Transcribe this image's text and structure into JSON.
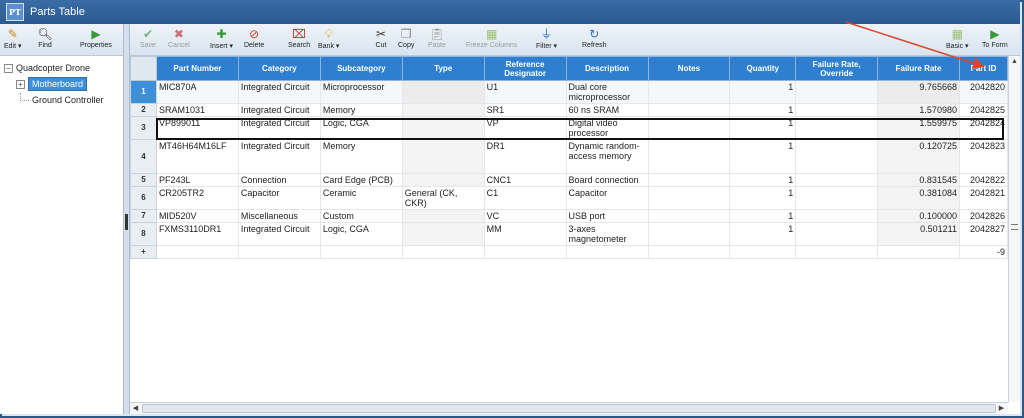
{
  "window": {
    "logo_text": "PT",
    "title": "Parts Table"
  },
  "left_toolbar": [
    {
      "label": "Edit ▾",
      "icon": "pencil-icon",
      "glyph": "✎",
      "color": "#d08a10"
    },
    {
      "label": "Find",
      "icon": "magnifier-icon",
      "glyph": "🔍︎",
      "color": "#333333"
    },
    {
      "label": "Properties",
      "icon": "play-icon",
      "glyph": "▶",
      "color": "#3a9a3a"
    }
  ],
  "tree": {
    "root": "Quadcopter Drone",
    "root_toggle": "−",
    "child_toggle": "+",
    "children": [
      "Motherboard",
      "Ground Controller"
    ]
  },
  "toolbar": [
    {
      "label": "Save",
      "icon": "check-icon",
      "glyph": "✔",
      "color": "#7ab07a",
      "disabled": true
    },
    {
      "label": "Cancel",
      "icon": "cancel-icon",
      "glyph": "✖",
      "color": "#d07070",
      "disabled": true
    },
    {
      "label": "Insert ▾",
      "icon": "add-icon",
      "glyph": "✚",
      "color": "#2e9a2e",
      "disabled": false
    },
    {
      "label": "Delete",
      "icon": "delete-icon",
      "glyph": "⊘",
      "color": "#d04020",
      "disabled": false
    },
    {
      "label": "Search",
      "icon": "search-icon",
      "glyph": "⌧",
      "color": "#c03030",
      "disabled": false
    },
    {
      "label": "Bank ▾",
      "icon": "lightbulb-icon",
      "glyph": "💡︎",
      "color": "#e0b020",
      "disabled": false
    },
    {
      "label": "Cut",
      "icon": "scissors-icon",
      "glyph": "✂",
      "color": "#333333",
      "disabled": false
    },
    {
      "label": "Copy",
      "icon": "copy-icon",
      "glyph": "❐",
      "color": "#888888",
      "disabled": false
    },
    {
      "label": "Paste",
      "icon": "paste-icon",
      "glyph": "📋︎",
      "color": "#999999",
      "disabled": true
    },
    {
      "label": "Freeze Columns",
      "icon": "freeze-columns-icon",
      "glyph": "▦",
      "color": "#9fbf70",
      "disabled": true
    },
    {
      "label": "Filter ▾",
      "icon": "filter-icon",
      "glyph": "⏚",
      "color": "#3070c0",
      "disabled": false
    },
    {
      "label": "Refresh",
      "icon": "refresh-icon",
      "glyph": "↻",
      "color": "#3070c0",
      "disabled": false
    },
    {
      "label": "Basic ▾",
      "icon": "basic-view-icon",
      "glyph": "▦",
      "color": "#9fbf70",
      "disabled": false
    },
    {
      "label": "To Form",
      "icon": "to-form-icon",
      "glyph": "▶",
      "color": "#3a9a3a",
      "disabled": false
    }
  ],
  "columns": [
    "Part Number",
    "Category",
    "Subcategory",
    "Type",
    "Reference Designator",
    "Description",
    "Notes",
    "Quantity",
    "Failure Rate, Override",
    "Failure Rate",
    "Part ID"
  ],
  "rows": [
    {
      "n": "1",
      "part": "MIC870A",
      "cat": "Integrated Circuit",
      "sub": "Microprocessor",
      "type": "",
      "ref": "U1",
      "desc": "Dual core microprocessor",
      "notes": "",
      "qty": "1",
      "fro": "",
      "fr": "9.765668",
      "id": "2042820"
    },
    {
      "n": "2",
      "part": "SRAM1031",
      "cat": "Integrated Circuit",
      "sub": "Memory",
      "type": "",
      "ref": "SR1",
      "desc": "60 ns SRAM",
      "notes": "",
      "qty": "1",
      "fro": "",
      "fr": "1.570980",
      "id": "2042825"
    },
    {
      "n": "3",
      "part": "VP899011",
      "cat": "Integrated Circuit",
      "sub": "Logic, CGA",
      "type": "",
      "ref": "VP",
      "desc": "Digital video processor",
      "notes": "",
      "qty": "1",
      "fro": "",
      "fr": "1.559975",
      "id": "2042824"
    },
    {
      "n": "4",
      "part": "MT46H64M16LF",
      "cat": "Integrated Circuit",
      "sub": "Memory",
      "type": "",
      "ref": "DR1",
      "desc": "Dynamic random-access memory",
      "notes": "",
      "qty": "1",
      "fro": "",
      "fr": "0.120725",
      "id": "2042823"
    },
    {
      "n": "5",
      "part": "PF243L",
      "cat": "Connection",
      "sub": "Card Edge (PCB)",
      "type": "",
      "ref": "CNC1",
      "desc": "Board connection",
      "notes": "",
      "qty": "1",
      "fro": "",
      "fr": "0.831545",
      "id": "2042822"
    },
    {
      "n": "6",
      "part": "CR205TR2",
      "cat": "Capacitor",
      "sub": "Ceramic",
      "type": "General (CK, CKR)",
      "ref": "C1",
      "desc": "Capacitor",
      "notes": "",
      "qty": "1",
      "fro": "",
      "fr": "0.381084",
      "id": "2042821"
    },
    {
      "n": "7",
      "part": "MID520V",
      "cat": "Miscellaneous",
      "sub": "Custom",
      "type": "",
      "ref": "VC",
      "desc": "USB port",
      "notes": "",
      "qty": "1",
      "fro": "",
      "fr": "0.100000",
      "id": "2042826"
    },
    {
      "n": "8",
      "part": "FXMS3110DR1",
      "cat": "Integrated Circuit",
      "sub": "Logic, CGA",
      "type": "",
      "ref": "MM",
      "desc": "3-axes magnetometer",
      "notes": "",
      "qty": "1",
      "fro": "",
      "fr": "0.501211",
      "id": "2042827"
    }
  ],
  "new_row": {
    "marker": "+",
    "part_id": "-9"
  },
  "colors": {
    "header_blue": "#2f7fd0",
    "title_bar": "#2a5a90",
    "annotation_arrow": "#e0442a"
  }
}
